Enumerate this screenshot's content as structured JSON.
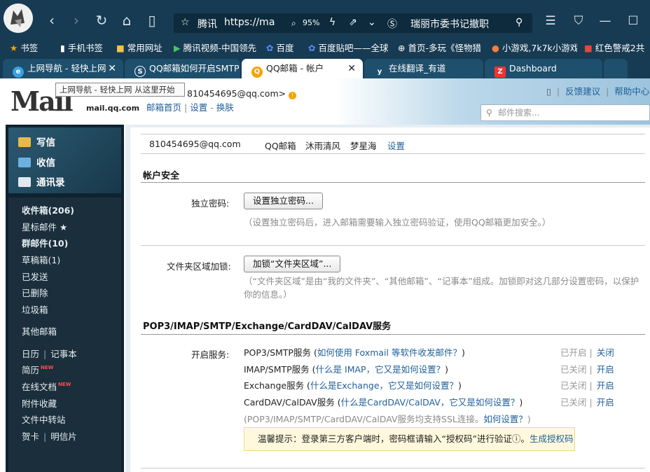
{
  "browser": {
    "address": {
      "site": "腾讯",
      "url": "https://ma",
      "zoom": "95%",
      "search_text": "瑞丽市委书记撤职"
    },
    "bookmarks": [
      {
        "label": "书签",
        "icon": "star-icon"
      },
      {
        "label": "手机书签",
        "icon": "phone-icon"
      },
      {
        "label": "常用网址",
        "icon": "folder-icon"
      },
      {
        "label": "腾讯视频-中国领先",
        "icon": "video-icon"
      },
      {
        "label": "百度",
        "icon": "baidu-icon"
      },
      {
        "label": "百度贴吧——全球",
        "icon": "baidu-icon"
      },
      {
        "label": "首页-多玩《怪物猎",
        "icon": "globe-icon"
      },
      {
        "label": "小游戏,7k7k小游戏",
        "icon": "game-icon"
      },
      {
        "label": "红色警戒2共",
        "icon": "game-icon"
      }
    ],
    "tabs": [
      {
        "label": "上网导航 - 轻快上网",
        "active": false
      },
      {
        "label": "QQ邮箱如何开启SMTP",
        "active": false
      },
      {
        "label": "QQ邮箱 - 帐户",
        "active": true
      },
      {
        "label": "在线翻译_有道",
        "active": false
      },
      {
        "label": "Dashboard",
        "active": false
      }
    ],
    "tooltip": "上网导航 - 轻快上网 从这里开始"
  },
  "mail_header": {
    "logo_text": "Mail",
    "logo_sub": "mail.qq.com",
    "account": "810454695@qq.com>",
    "links": [
      "邮箱首页",
      "设置",
      "换肤"
    ],
    "right_links": [
      "反馈建议",
      "帮助中心"
    ],
    "search_placeholder": "邮件搜索..."
  },
  "sidebar": {
    "actions": [
      "写信",
      "收信",
      "通讯录"
    ],
    "folders": [
      {
        "label": "收件箱(206)",
        "bold": true
      },
      {
        "label": "星标邮件 ★",
        "bold": false
      },
      {
        "label": "群邮件(10)",
        "bold": true
      },
      {
        "label": "草稿箱(1)",
        "bold": false
      },
      {
        "label": "已发送",
        "bold": false
      },
      {
        "label": "已删除",
        "bold": false
      },
      {
        "label": "垃圾箱",
        "bold": false
      },
      {
        "label": "其他邮箱",
        "bold": false
      }
    ],
    "extra": {
      "calendar": "日历",
      "notes": "记事本",
      "resume": "简历",
      "resume_badge": "NEW",
      "docs": "在线文档",
      "docs_badge": "NEW",
      "attachments": "附件收藏",
      "transfer": "文件中转站",
      "card": "贺卡",
      "postcard": "明信片"
    }
  },
  "main": {
    "subnav": [
      "810454695@qq.com",
      "QQ邮箱",
      "沐雨清风",
      "梦星海",
      "设置"
    ],
    "account_security": {
      "title": "帐户安全",
      "password_label": "独立密码:",
      "password_button": "设置独立密码...",
      "password_hint": "（设置独立密码后，进入邮箱需要输入独立密码验证，使用QQ邮箱更加安全。）",
      "folder_label": "文件夹区域加锁:",
      "folder_button": "加锁“文件夹区域”...",
      "folder_hint": "（“文件夹区域”是由“我的文件夹”、“其他邮箱”、“记事本”组成。加锁即对这几部分设置密码，以保护你的信息。）"
    },
    "services": {
      "title": "POP3/IMAP/SMTP/Exchange/CardDAV/CalDAV服务",
      "label": "开启服务:",
      "items": [
        {
          "name": "POP3/SMTP服务",
          "help": "如何使用 Foxmail 等软件收发邮件？",
          "status": "已开启",
          "action": "关闭"
        },
        {
          "name": "IMAP/SMTP服务",
          "help": "什么是 IMAP，它又是如何设置？",
          "status": "已关闭",
          "action": "开启"
        },
        {
          "name": "Exchange服务",
          "help": "什么是Exchange，它又是如何设置？",
          "status": "已关闭",
          "action": "开启"
        },
        {
          "name": "CardDAV/CalDAV服务",
          "help": "什么是CardDAV/CalDAV，它又是如何设置？",
          "status": "已关闭",
          "action": "开启"
        }
      ],
      "ssl_note": "(POP3/IMAP/SMTP/CardDAV/CalDAV服务均支持SSL连接。",
      "ssl_link": "如何设置？",
      "tip_text": "温馨提示：登录第三方客户端时，密码框请输入“授权码”进行验证ⓘ。",
      "tip_link": "生成授权码"
    }
  },
  "colors": {
    "chrome": "#173b53",
    "link": "#1f5f99",
    "sidebar": "#0e2230",
    "tip_bg": "#fff8dc"
  }
}
